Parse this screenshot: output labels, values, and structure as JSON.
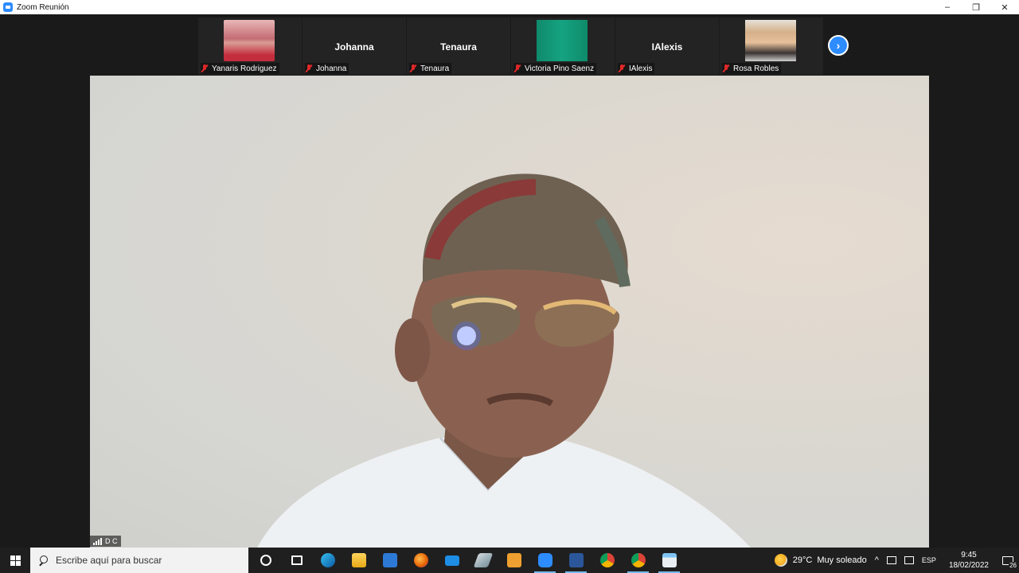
{
  "window": {
    "title": "Zoom Reunión",
    "minimize": "–",
    "restore": "❐",
    "close": "✕"
  },
  "participants": [
    {
      "label": "Yanaris Rodriguez",
      "display": "",
      "muted": true,
      "video": "photo"
    },
    {
      "label": "Johanna",
      "display": "Johanna",
      "muted": true,
      "video": "off"
    },
    {
      "label": "Tenaura",
      "display": "Tenaura",
      "muted": true,
      "video": "off"
    },
    {
      "label": "Victoria Pino Saenz",
      "display": "",
      "muted": true,
      "video": "teal"
    },
    {
      "label": "IAlexis",
      "display": "IAlexis",
      "muted": true,
      "video": "off"
    },
    {
      "label": "Rosa Robles",
      "display": "",
      "muted": true,
      "video": "photo"
    }
  ],
  "next_page": "›",
  "main_video": {
    "badge": "D C"
  },
  "taskbar": {
    "search_placeholder": "Escribe aquí para buscar",
    "pinned": [
      "cortana-icon",
      "task-view-icon",
      "edge-icon",
      "file-explorer-icon",
      "store-icon",
      "firefox-icon",
      "mail-icon",
      "feather-icon",
      "media-player-icon",
      "zoom-icon",
      "word-icon",
      "chrome-icon",
      "chrome-profile-icon",
      "notepad-icon"
    ],
    "weather": {
      "temp": "29°C",
      "condition": "Muy soleado"
    },
    "tray_arrow": "^",
    "language": "ESP",
    "time": "9:45",
    "date": "18/02/2022",
    "notifications": "26"
  },
  "colors": {
    "zoom_blue": "#2d8cff",
    "muted_red": "#e02828",
    "taskbar": "#1f1f1f"
  }
}
